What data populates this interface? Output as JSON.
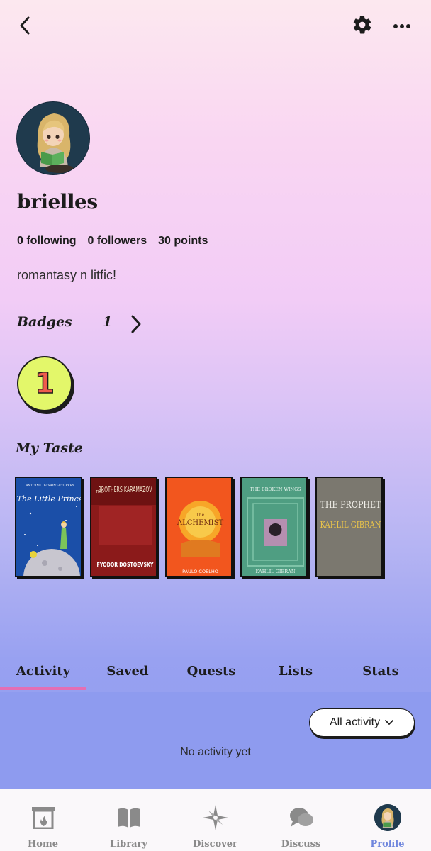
{
  "header": {
    "back_icon": "chevron-left-icon",
    "settings_icon": "gear-icon",
    "more_icon": "more-horizontal-icon"
  },
  "profile": {
    "avatar_icon": "avatar-reading-girl",
    "username": "brielles",
    "following": "0 following",
    "followers": "0 followers",
    "points": "30 points",
    "bio": "romantasy n litfic!"
  },
  "badges": {
    "title": "Badges",
    "count": "1",
    "badge_label": "1",
    "badge_color": "#e3f76a",
    "badge_text_color": "#ef5b4c"
  },
  "taste": {
    "title": "My Taste",
    "books": [
      {
        "title": "The Little Prince",
        "author": "ANTOINE DE SAINT-EXUPÉRY",
        "color": "#1b4fa8"
      },
      {
        "title": "BROTHERS KARAMAZOV",
        "prefix": "THE",
        "author": "FYODOR DOSTOEVSKY",
        "color": "#8b1a1a"
      },
      {
        "title": "ALCHEMIST",
        "prefix": "The",
        "author": "PAULO COELHO",
        "color": "#f2561e"
      },
      {
        "title": "THE BROKEN WINGS",
        "author": "KAHLIL GIBRAN",
        "color": "#4f9e82"
      },
      {
        "title": "THE PROPHET",
        "author": "KAHLIL GIBRAN",
        "color": "#7b786f"
      }
    ]
  },
  "tabs": {
    "items": [
      "Activity",
      "Saved",
      "Quests",
      "Lists",
      "Stats"
    ],
    "active": "Activity",
    "indicator_color": "#e46fb4"
  },
  "activity": {
    "filter_label": "All activity",
    "empty_message": "No activity yet"
  },
  "nav": {
    "items": [
      {
        "label": "Home",
        "icon": "fireplace-icon"
      },
      {
        "label": "Library",
        "icon": "book-icon"
      },
      {
        "label": "Discover",
        "icon": "compass-icon"
      },
      {
        "label": "Discuss",
        "icon": "chat-bubbles-icon"
      },
      {
        "label": "Profile",
        "icon": "avatar"
      }
    ],
    "active": "Profile",
    "active_color": "#6f86dd"
  }
}
